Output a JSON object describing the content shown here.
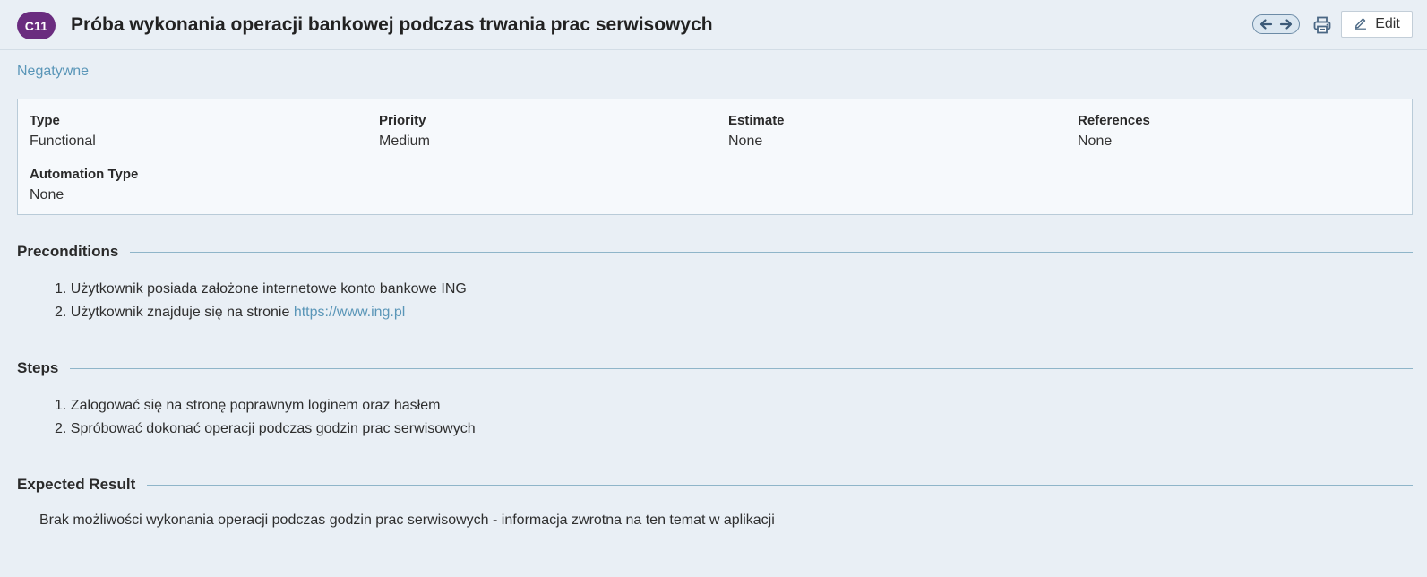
{
  "header": {
    "case_id": "C11",
    "title": "Próba wykonania operacji bankowej podczas trwania prac serwisowych",
    "edit_label": "Edit",
    "icons": {
      "prev": "arrow-left-icon",
      "next": "arrow-right-icon",
      "print": "printer-icon",
      "edit": "pencil-icon"
    }
  },
  "section_link": "Negatywne",
  "info": {
    "type": {
      "label": "Type",
      "value": "Functional"
    },
    "priority": {
      "label": "Priority",
      "value": "Medium"
    },
    "estimate": {
      "label": "Estimate",
      "value": "None"
    },
    "references": {
      "label": "References",
      "value": "None"
    },
    "automation_type": {
      "label": "Automation Type",
      "value": "None"
    }
  },
  "preconditions": {
    "heading": "Preconditions",
    "items": [
      {
        "num": "1.",
        "text": "Użytkownik posiada założone internetowe konto bankowe ING"
      },
      {
        "num": "2.",
        "text": "Użytkownik znajduje się na stronie ",
        "link": "https://www.ing.pl"
      }
    ]
  },
  "steps": {
    "heading": "Steps",
    "items": [
      {
        "num": "1.",
        "text": "Zalogować się na stronę poprawnym loginem oraz hasłem"
      },
      {
        "num": "2.",
        "text": "Spróbować dokonać operacji podczas godzin prac serwisowych"
      }
    ]
  },
  "expected_result": {
    "heading": "Expected Result",
    "text": "Brak możliwości wykonania operacji podczas godzin prac serwisowych - informacja zwrotna na ten temat w aplikacji"
  },
  "colors": {
    "background": "#e9eff5",
    "badge": "#6a2c7f",
    "link": "#5a96b8",
    "rule": "#8fb5c9",
    "panel": "#f6f9fc"
  }
}
